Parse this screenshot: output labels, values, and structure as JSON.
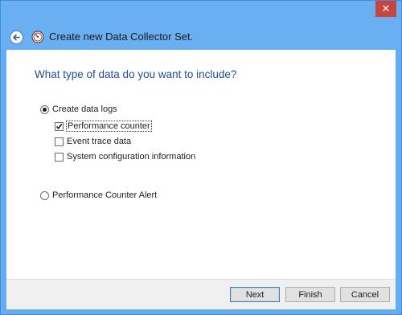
{
  "window": {
    "title": "Create new Data Collector Set.",
    "close_glyph": "✕"
  },
  "icons": {
    "back": "back-arrow-icon",
    "app": "performance-monitor-icon",
    "close": "close-icon"
  },
  "page": {
    "question": "What type of data do you want to include?"
  },
  "options": {
    "create_logs": {
      "label": "Create data logs",
      "selected": true
    },
    "perf_counter": {
      "label": "Performance counter",
      "checked": true
    },
    "event_trace": {
      "label": "Event trace data",
      "checked": false
    },
    "sys_config": {
      "label": "System configuration information",
      "checked": false
    },
    "perf_alert": {
      "label": "Performance Counter Alert",
      "selected": false
    }
  },
  "buttons": {
    "next": "Next",
    "finish": "Finish",
    "cancel": "Cancel"
  },
  "colors": {
    "titlebar": "#6aaff1",
    "close": "#c7453e",
    "heading": "#1f4e9b"
  }
}
